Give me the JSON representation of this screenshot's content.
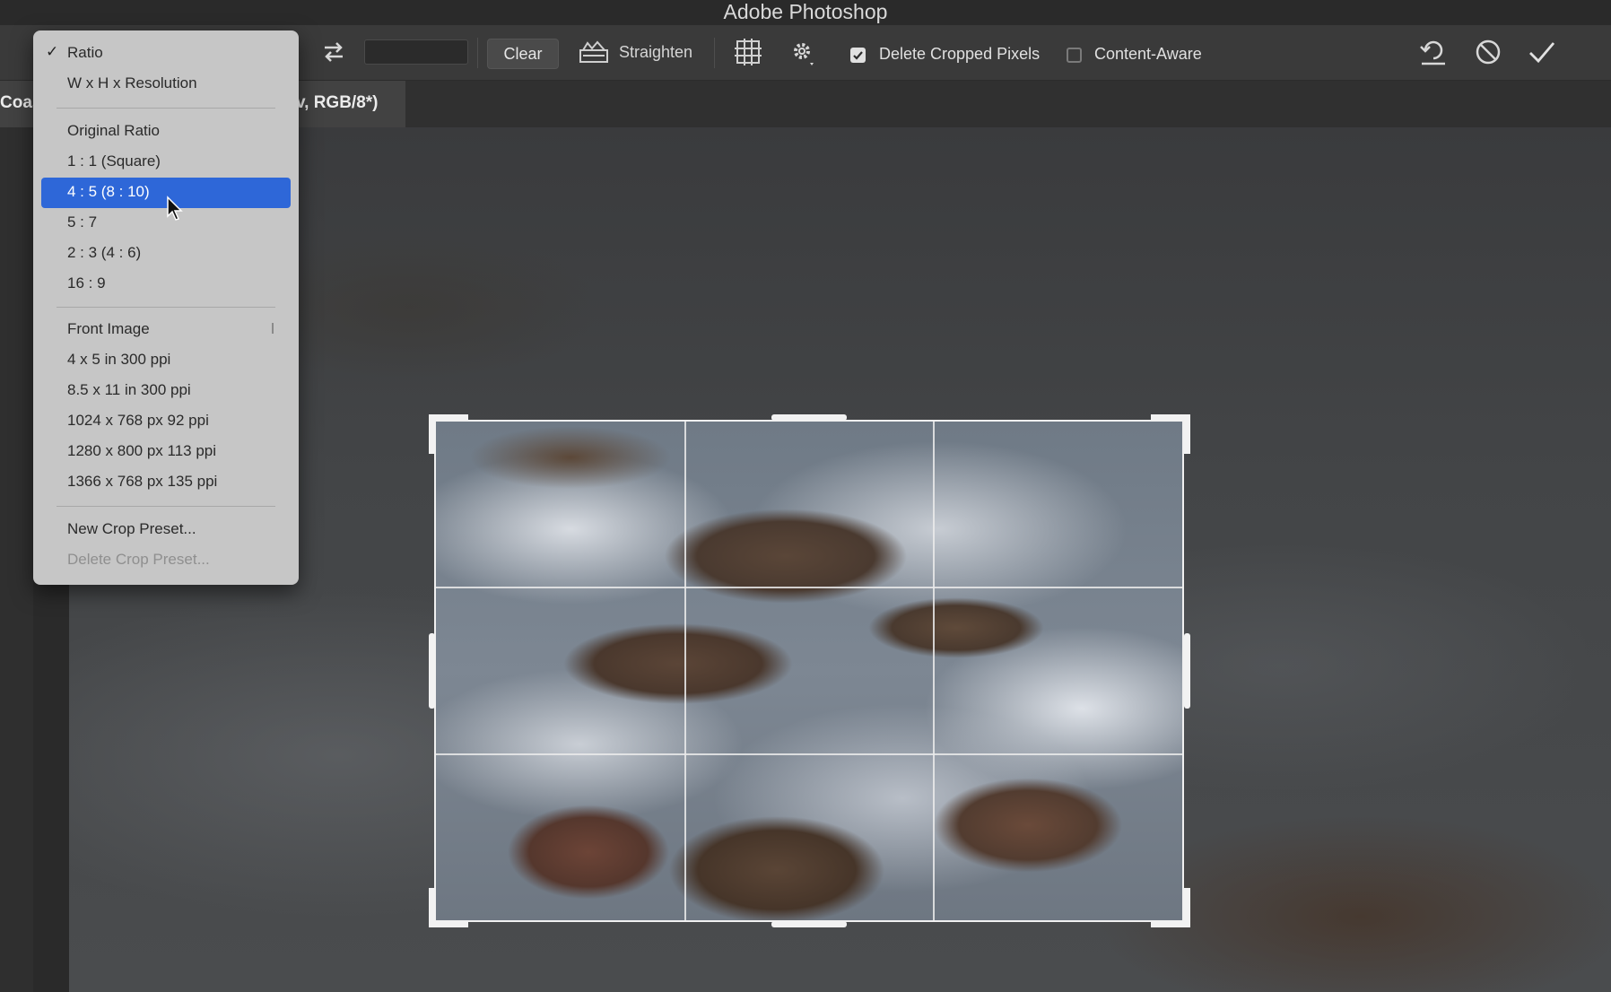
{
  "app": {
    "title": "Adobe Photoshop"
  },
  "options_bar": {
    "clear_label": "Clear",
    "straighten_label": "Straighten",
    "delete_cropped_pixels": {
      "label": "Delete Cropped Pixels",
      "checked": true
    },
    "content_aware": {
      "label": "Content-Aware",
      "checked": false
    }
  },
  "document_tab": {
    "title_left": "Coas",
    "title_right": "v, RGB/8*)"
  },
  "ratio_menu": {
    "items": [
      {
        "label": "Ratio",
        "checked": true
      },
      {
        "label": "W x H x Resolution"
      },
      {
        "label": "Original Ratio"
      },
      {
        "label": "1 : 1 (Square)"
      },
      {
        "label": "4 : 5 (8 : 10)",
        "highlighted": true
      },
      {
        "label": "5 : 7"
      },
      {
        "label": "2 : 3 (4 : 6)"
      },
      {
        "label": "16 : 9"
      },
      {
        "label": "Front Image"
      },
      {
        "label": "4 x 5 in 300 ppi"
      },
      {
        "label": "8.5 x 11 in 300 ppi"
      },
      {
        "label": "1024 x 768 px 92 ppi"
      },
      {
        "label": "1280 x 800 px 113 ppi"
      },
      {
        "label": "1366 x 768 px 135 ppi"
      },
      {
        "label": "New Crop Preset..."
      },
      {
        "label": "Delete Crop Preset...",
        "disabled": true
      }
    ]
  },
  "colors": {
    "menu_highlight": "#2e67d8",
    "menu_background": "#c6c6c6",
    "options_bar": "#3a3a3a"
  },
  "icons": [
    "swap-orientation-icon",
    "straighten-icon",
    "overlay-grid-icon",
    "gear-icon",
    "reset-icon",
    "cancel-icon",
    "commit-check-icon",
    "pointer-cursor-icon"
  ]
}
